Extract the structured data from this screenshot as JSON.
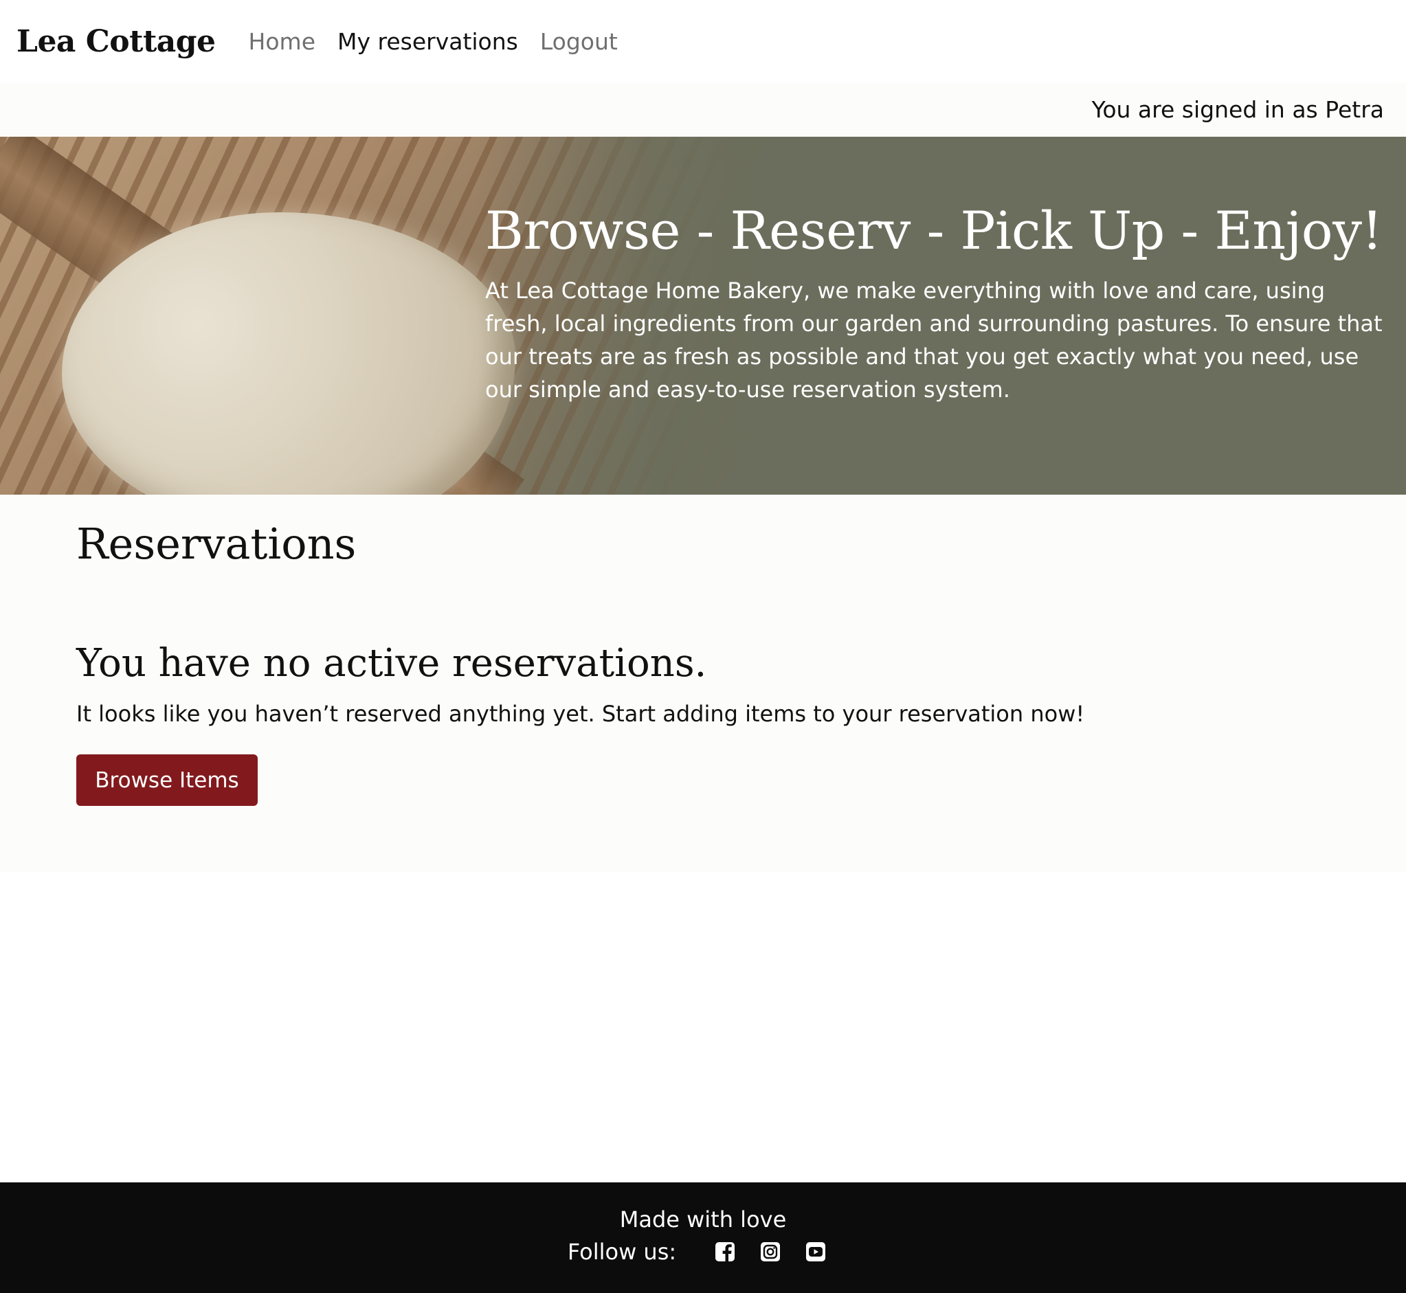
{
  "navbar": {
    "brand": "Lea Cottage",
    "links": [
      {
        "label": "Home",
        "active": false
      },
      {
        "label": "My reservations",
        "active": true
      },
      {
        "label": "Logout",
        "active": false
      }
    ]
  },
  "session": {
    "signed_in_text": "You are signed in as Petra"
  },
  "hero": {
    "title": "Browse - Reserv - Pick Up - Enjoy!",
    "text": "At Lea Cottage Home Bakery, we make everything with love and care, using fresh, local ingredients from our garden and surrounding pastures. To ensure that our treats are as fresh as possible and that you get exactly what you need, use our simple and easy-to-use reservation system."
  },
  "main": {
    "title": "Reservations",
    "empty_title": "You have no active reservations.",
    "empty_text": "It looks like you haven’t reserved anything yet. Start adding items to your reservation now!",
    "browse_label": "Browse Items"
  },
  "footer": {
    "made_with": "Made with love",
    "follow_label": "Follow us:",
    "social_icons": [
      "facebook-icon",
      "instagram-icon",
      "youtube-icon"
    ]
  },
  "colors": {
    "accent": "#821a1d",
    "hero_bg": "#6b6e5c",
    "footer_bg": "#0b0c0b",
    "page_bg": "#fcfdfb"
  }
}
